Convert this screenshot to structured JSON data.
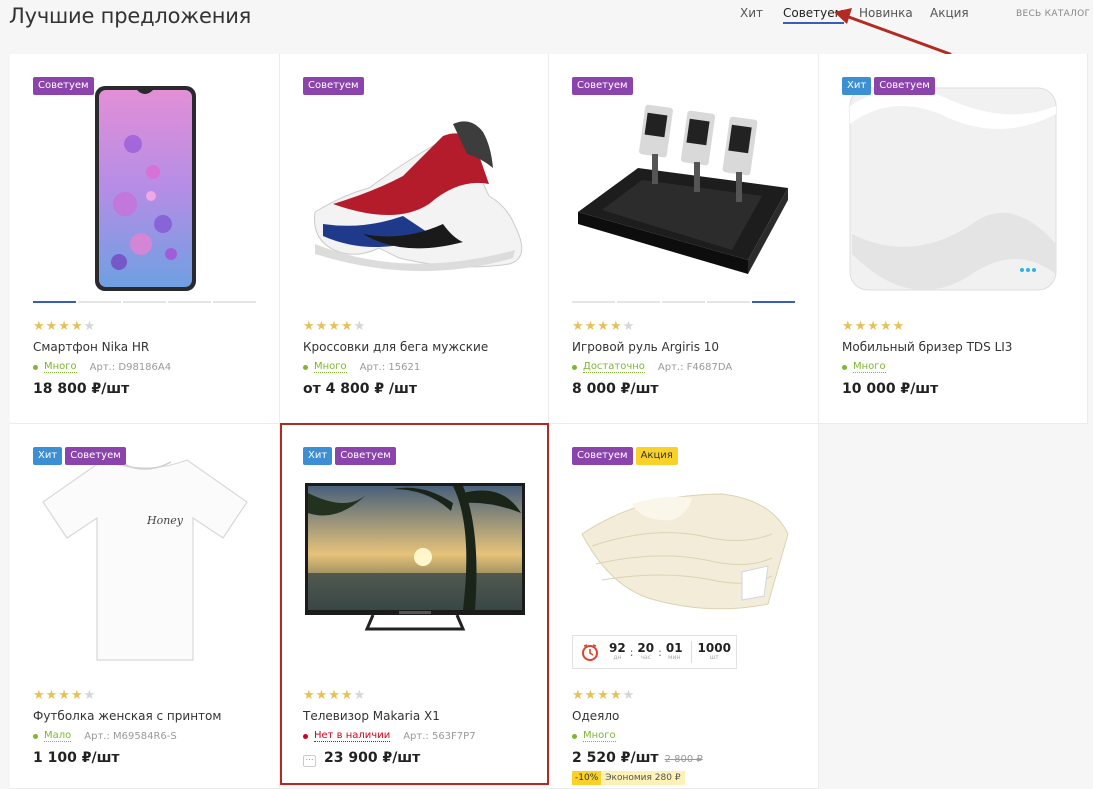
{
  "header": {
    "title": "Лучшие предложения",
    "tabs": [
      "Хит",
      "Советуем",
      "Новинка",
      "Акция"
    ],
    "active_tab": "Советуем",
    "catalog_link": "ВЕСЬ КАТАЛОГ"
  },
  "colors": {
    "highlight_border": "#b22a21",
    "badge_hit": "#3d8fd4",
    "badge_recommend": "#8c44ad",
    "badge_promo": "#f8d22a",
    "star": "#e6c157"
  },
  "products": [
    {
      "badges": [
        "Советуем"
      ],
      "stars": 4,
      "name": "Смартфон Nika HR",
      "stock": "Много",
      "stock_color": "#7fb534",
      "article": "Арт.: D98186A4",
      "price": "18 800 ₽/шт",
      "image": "smartphone-image"
    },
    {
      "badges": [
        "Советуем"
      ],
      "stars": 4,
      "name": "Кроссовки для бега мужские",
      "stock": "Много",
      "stock_color": "#7fb534",
      "article": "Арт.: 15621",
      "price": "от 4 800 ₽ /шт",
      "image": "sneakers-image"
    },
    {
      "badges": [
        "Советуем"
      ],
      "stars": 4,
      "name": "Игровой руль Argiris 10",
      "stock": "Достаточно",
      "stock_color": "#7fb534",
      "article": "Арт.: F4687DA",
      "price": "8 000 ₽/шт",
      "image": "pedals-image"
    },
    {
      "badges": [
        "Хит",
        "Советуем"
      ],
      "stars": 5,
      "name": "Мобильный бризер TDS LI3",
      "stock": "Много",
      "stock_color": "#7fb534",
      "article": "",
      "price": "10 000 ₽/шт",
      "image": "breezer-image"
    },
    {
      "badges": [
        "Хит",
        "Советуем"
      ],
      "stars": 4,
      "name": "Футболка женская с принтом",
      "stock": "Мало",
      "stock_color": "#7fb534",
      "article": "Арт.: M69584R6-S",
      "price": "1 100 ₽/шт",
      "image": "tshirt-image",
      "tshirt_text": "Honey"
    },
    {
      "badges": [
        "Хит",
        "Советуем"
      ],
      "stars": 4,
      "name": "Телевизор Makaria X1",
      "stock": "Нет в наличии",
      "stock_color": "#d0021b",
      "article": "Арт.: 563F7P7",
      "price": "23 900 ₽/шт",
      "qty_icon": "···",
      "image": "tv-image",
      "highlighted": true
    },
    {
      "badges": [
        "Советуем",
        "Акция"
      ],
      "stars": 4,
      "name": "Одеяло",
      "stock": "Много",
      "stock_color": "#7fb534",
      "article": "",
      "price": "2 520 ₽/шт",
      "old_price": "2 800 ₽",
      "discount_pct": "-10%",
      "discount_save": "Экономия 280 ₽",
      "image": "blanket-image",
      "timer": {
        "days": "92",
        "days_label": "дн",
        "hours": "20",
        "hours_label": "час",
        "minutes": "01",
        "minutes_label": "мин",
        "qty": "1000",
        "qty_label": "шт"
      }
    }
  ]
}
